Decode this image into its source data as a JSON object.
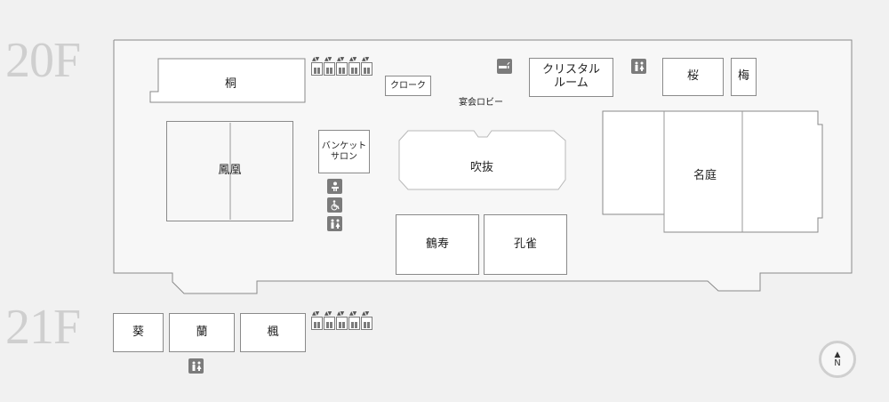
{
  "floors": [
    {
      "label": "20F",
      "rooms": {
        "kiri": "桐",
        "cloak": "クローク",
        "crystal_room": "クリスタル\nルーム",
        "sakura": "桜",
        "ume": "梅",
        "houou": "鳳凰",
        "banquet_salon": "バンケット\nサロン",
        "suihan": "吹抜",
        "meitei": "名庭",
        "kakuju": "鶴寿",
        "kujaku": "孔雀"
      },
      "lobby_label": "宴会ロビー"
    },
    {
      "label": "21F",
      "rooms": {
        "aoi": "葵",
        "ran": "蘭",
        "kaede": "楓"
      }
    }
  ],
  "compass_label": "N",
  "icons": [
    "elevator-icon",
    "smoking-area-icon",
    "restroom-icon",
    "baby-care-icon",
    "wheelchair-accessible-icon"
  ]
}
